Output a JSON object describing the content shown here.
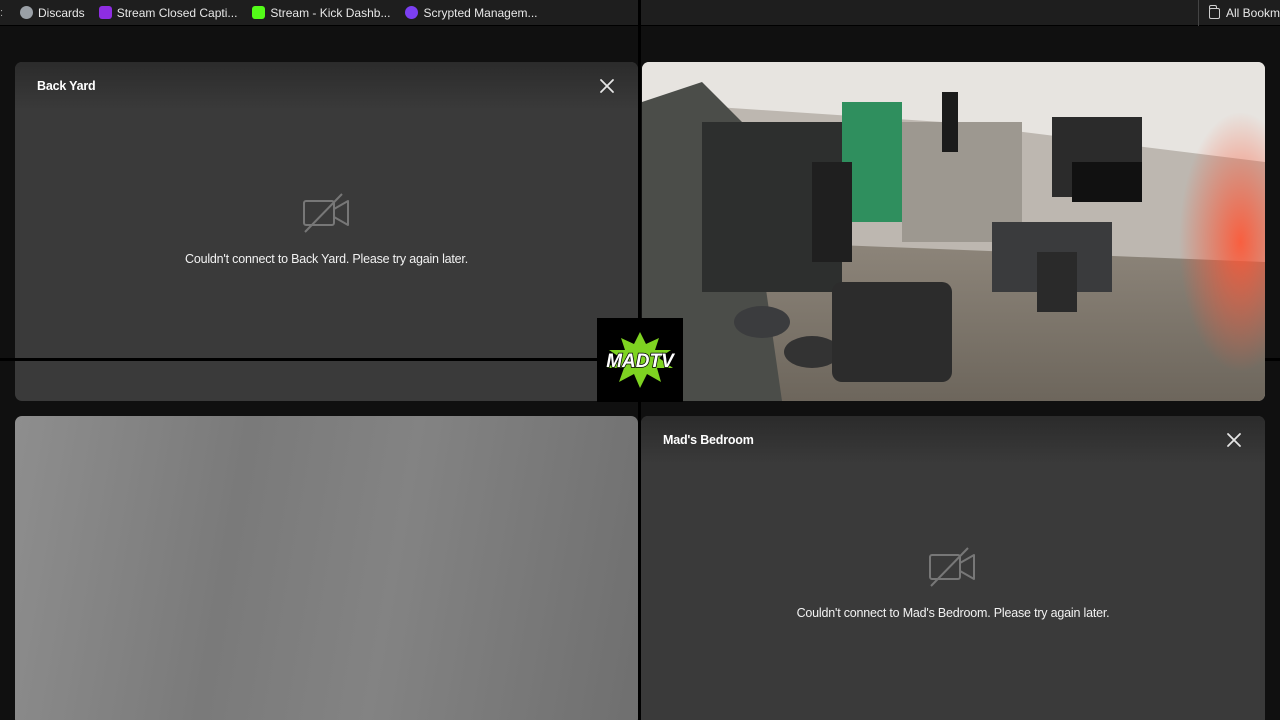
{
  "bookmarks": {
    "items": [
      {
        "label": "Discards",
        "icon": "globe-icon",
        "color": "#9aa0a6"
      },
      {
        "label": "Stream Closed Capti...",
        "icon": "captions-icon",
        "color": "#8e2de2"
      },
      {
        "label": "Stream - Kick Dashb...",
        "icon": "kick-icon",
        "color": "#53fc18"
      },
      {
        "label": "Scrypted Managem...",
        "icon": "scrypted-icon",
        "color": "#7b3ff2"
      }
    ],
    "all_label": "All Bookm"
  },
  "tiles": {
    "back_yard": {
      "title": "Back Yard",
      "error": "Couldn't connect to Back Yard. Please try again later."
    },
    "bedroom": {
      "title": "Mad's Bedroom",
      "error": "Couldn't connect to Mad's Bedroom. Please try again later."
    }
  },
  "logo": {
    "text": "MADTV",
    "accent": "#7ed321"
  }
}
